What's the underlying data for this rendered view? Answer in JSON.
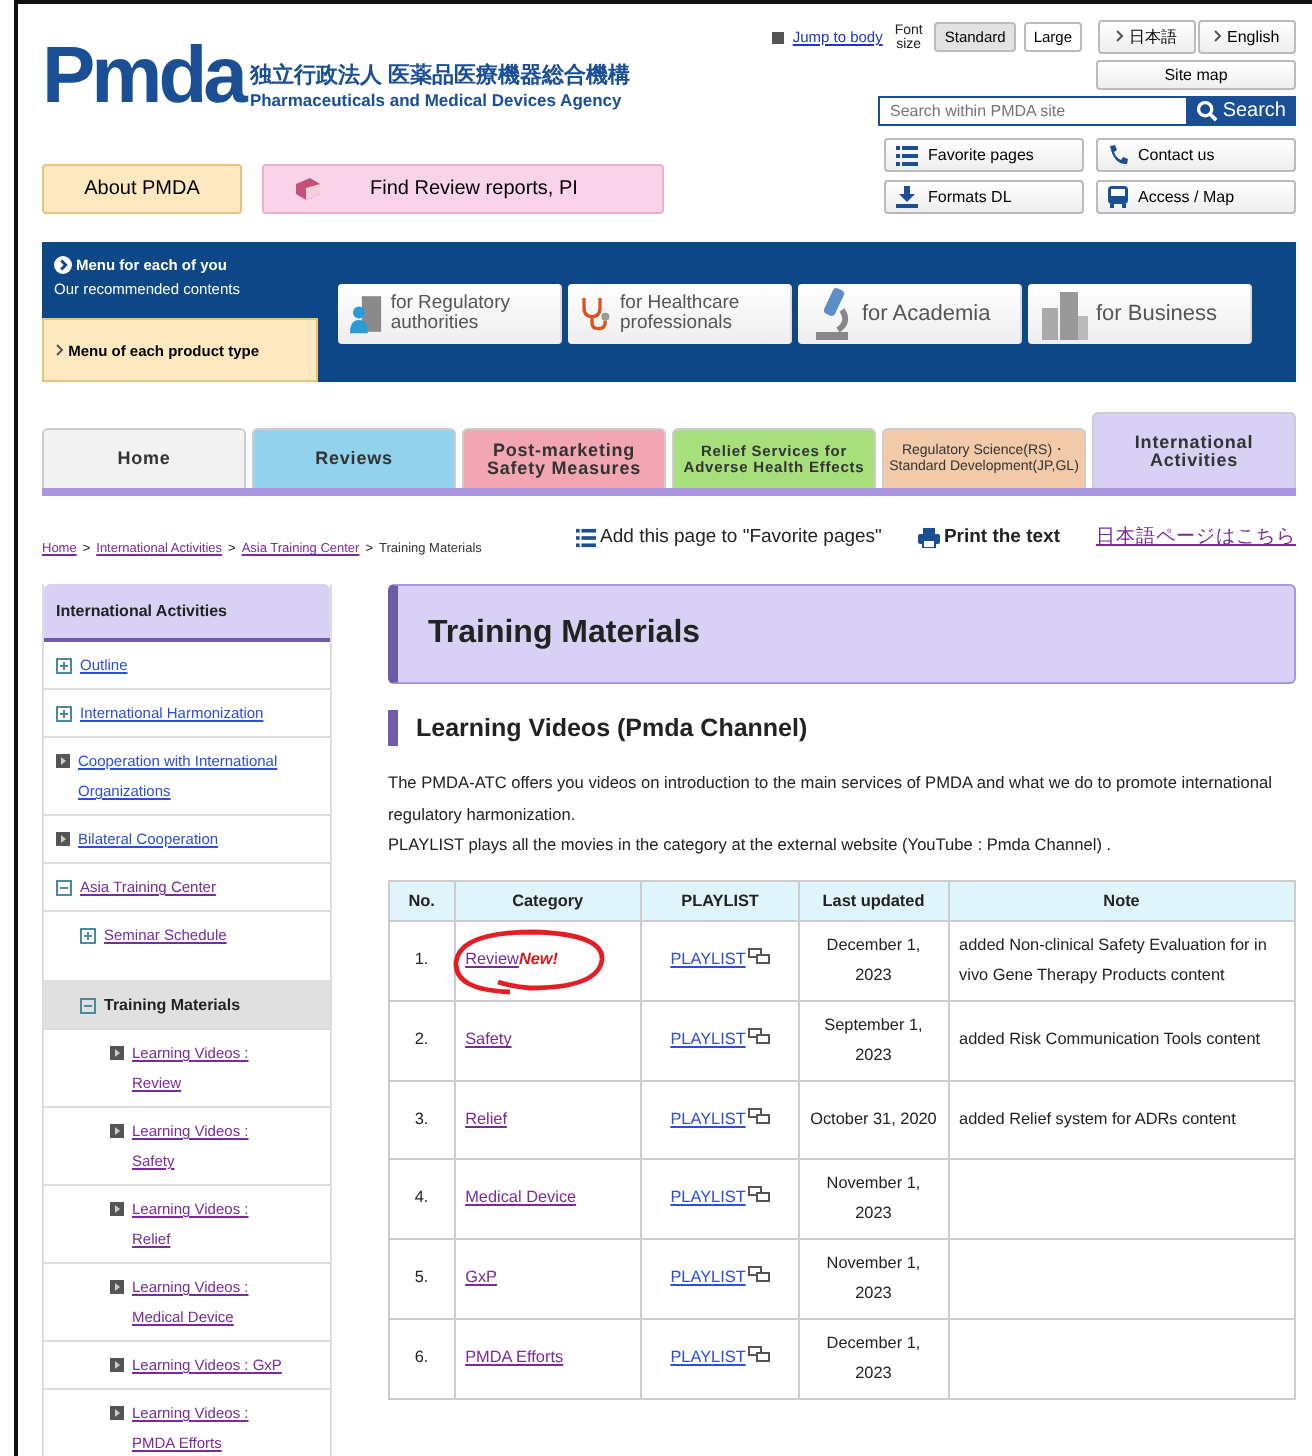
{
  "header": {
    "logo": "Pmda",
    "name_ja": "独立行政法人 医薬品医療機器総合機構",
    "name_en": "Pharmaceuticals and Medical Devices Agency",
    "jump": "Jump to body",
    "font_size_label": "Font size",
    "font_sizes": [
      {
        "label": "Standard",
        "selected": true
      },
      {
        "label": "Large",
        "selected": false
      }
    ],
    "languages": [
      "日本語",
      "English"
    ],
    "site_map": "Site map",
    "search": {
      "placeholder": "Search within PMDA site",
      "button": "Search"
    },
    "tools": [
      {
        "kind": "favorite",
        "label": "Favorite pages"
      },
      {
        "kind": "contact",
        "label": "Contact us"
      },
      {
        "kind": "download",
        "label": "Formats DL"
      },
      {
        "kind": "access",
        "label": "Access / Map"
      }
    ],
    "about": "About PMDA",
    "find": "Find Review reports, PI"
  },
  "audience": {
    "title": "Menu for each of you",
    "subtitle": "Our recommended contents",
    "product_menu": "Menu of each product type",
    "cards": [
      {
        "kind": "regulatory",
        "label": "for  Regulatory authorities"
      },
      {
        "kind": "healthcare",
        "label": "for Healthcare professionals"
      },
      {
        "kind": "academia",
        "label": "for Academia"
      },
      {
        "kind": "business",
        "label": "for Business"
      }
    ]
  },
  "tabs": [
    {
      "label": "Home",
      "color": "#f2f2f2",
      "selected": false
    },
    {
      "label": "Reviews",
      "color": "#92d2ec",
      "selected": false
    },
    {
      "label": "Post-marketing Safety Measures",
      "color": "#f2a6b4",
      "selected": false
    },
    {
      "label": "Relief Services for Adverse Health Effects",
      "color": "#a6df7c",
      "selected": false
    },
    {
      "label": "Regulatory Science(RS)・Standard Development(JP,GL)",
      "color": "#f2caa9",
      "selected": false
    },
    {
      "label": "International Activities",
      "color": "#d9d1f5",
      "selected": true
    }
  ],
  "breadcrumb": [
    {
      "label": "Home",
      "separator": ">"
    },
    {
      "label": "International Activities",
      "separator": ">"
    },
    {
      "label": "Asia Training Center",
      "separator": ">"
    },
    {
      "label": "Training Materials"
    }
  ],
  "page_tools": {
    "favorite": "Add this page to \"Favorite pages\"",
    "print": "Print the text",
    "japanese": "日本語ページはこちら"
  },
  "sidebar": {
    "title": "International Activities",
    "items": [
      {
        "kind": "expand",
        "label": "Outline",
        "visited": false,
        "selected": false
      },
      {
        "kind": "expand",
        "label": "International Harmonization",
        "visited": false,
        "selected": false
      },
      {
        "kind": "page",
        "label": "Cooperation with International Organizations",
        "visited": false,
        "selected": false
      },
      {
        "kind": "page",
        "label": "Bilateral Cooperation",
        "visited": false,
        "selected": false
      },
      {
        "kind": "collapse",
        "label": "Asia Training Center",
        "visited": true,
        "selected": false,
        "children": [
          {
            "kind": "expand",
            "label": "Seminar Schedule",
            "visited": true,
            "selected": false
          },
          {
            "kind": "collapse",
            "label": "Training Materials",
            "selected": true,
            "children": [
              {
                "kind": "page",
                "label": "Learning Videos : Review",
                "visited": true,
                "selected": false
              },
              {
                "kind": "page",
                "label": "Learning Videos : Safety",
                "visited": true,
                "selected": false
              },
              {
                "kind": "page",
                "label": "Learning Videos : Relief",
                "visited": true,
                "selected": false
              },
              {
                "kind": "page",
                "label": "Learning Videos : Medical Device",
                "visited": true,
                "selected": false
              },
              {
                "kind": "page",
                "label": "Learning Videos : GxP",
                "visited": true,
                "selected": false
              },
              {
                "kind": "page",
                "label": "Learning Videos : PMDA Efforts",
                "visited": true,
                "selected": false
              }
            ]
          }
        ]
      }
    ]
  },
  "title": "Training Materials",
  "section": "Learning Videos (Pmda Channel)",
  "intro": [
    "The PMDA-ATC offers you videos on introduction to the main services of PMDA and what we do to promote international regulatory harmonization.",
    "PLAYLIST plays all the movies in the category at the external website (YouTube : Pmda Channel) ."
  ],
  "table": {
    "columns": [
      "No.",
      "Category",
      "PLAYLIST",
      "Last updated",
      "Note"
    ],
    "rows": [
      {
        "no": "1.",
        "category": "Review",
        "new": "New!",
        "playlist": "PLAYLIST",
        "updated": "December 1, 2023",
        "note": "added Non-clinical Safety Evaluation for in vivo Gene Therapy Products content",
        "highlighted": true
      },
      {
        "no": "2.",
        "category": "Safety",
        "playlist": "PLAYLIST",
        "updated": "September 1, 2023",
        "note": "added Risk Communication Tools content"
      },
      {
        "no": "3.",
        "category": "Relief",
        "playlist": "PLAYLIST",
        "updated": "October 31, 2020",
        "note": "added Relief system for ADRs content"
      },
      {
        "no": "4.",
        "category": "Medical Device",
        "playlist": "PLAYLIST",
        "updated": "November 1, 2023"
      },
      {
        "no": "5.",
        "category": "GxP",
        "playlist": "PLAYLIST",
        "updated": "November 1, 2023"
      },
      {
        "no": "6.",
        "category": "PMDA Efforts",
        "playlist": "PLAYLIST",
        "updated": "December 1, 2023"
      }
    ]
  }
}
